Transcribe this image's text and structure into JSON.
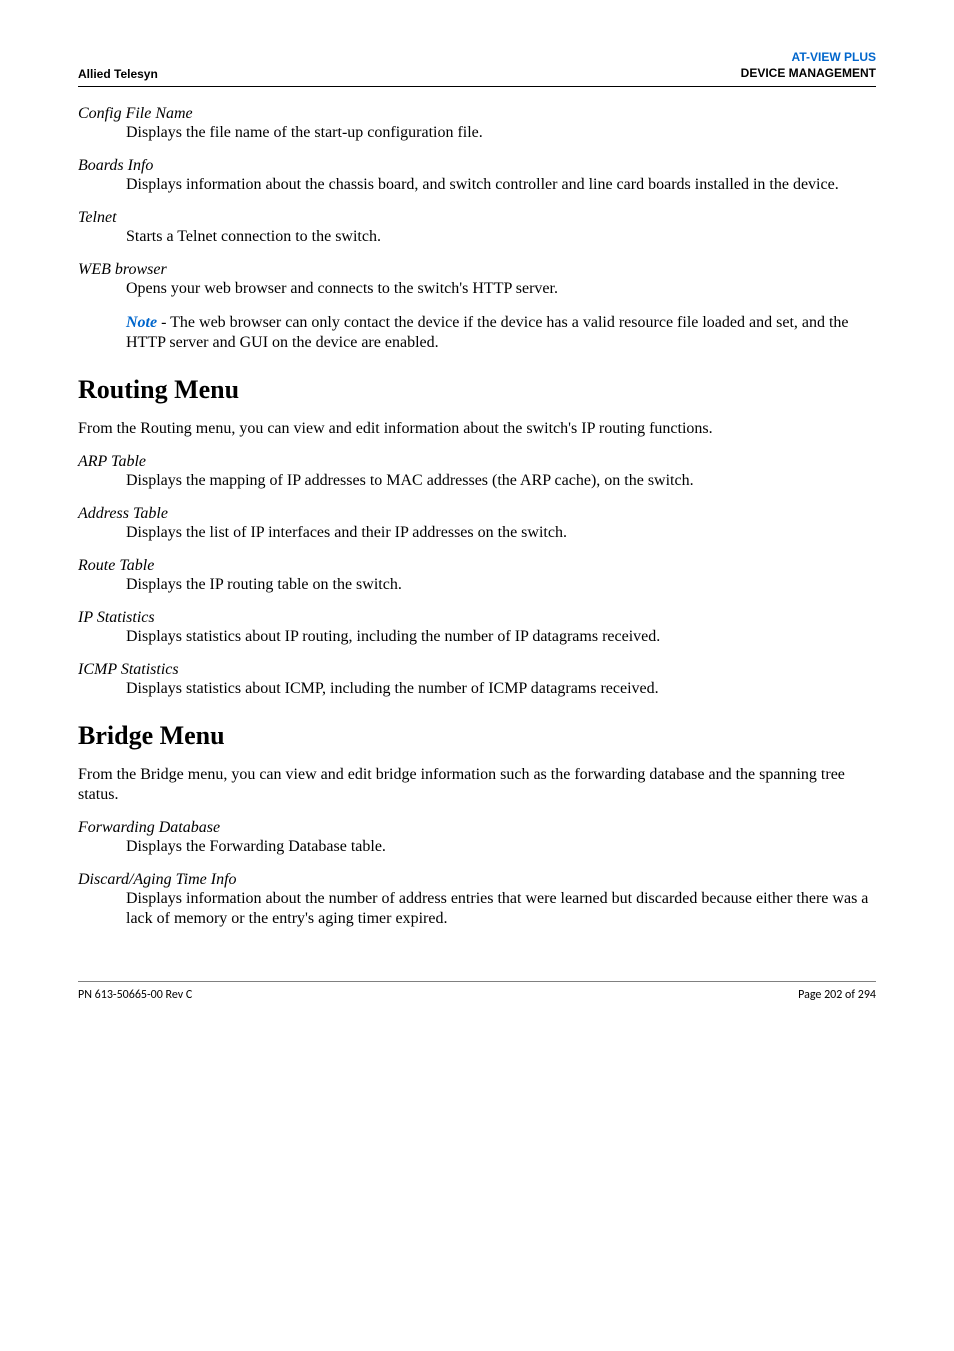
{
  "header": {
    "left": "Allied Telesyn",
    "right_line1": "AT-VIEW PLUS",
    "right_line2": "DEVICE MANAGEMENT"
  },
  "items1": {
    "config_file_name": {
      "term": "Config File Name",
      "desc": "Displays the file name of the start-up configuration file."
    },
    "boards_info": {
      "term": "Boards Info",
      "desc": "Displays information about the chassis board, and switch controller and line card boards installed in the device."
    },
    "telnet": {
      "term": "Telnet",
      "desc": "Starts a Telnet connection to the switch."
    },
    "web_browser": {
      "term": "WEB browser",
      "desc": "Opens your web browser and connects to the switch's HTTP server."
    }
  },
  "note": {
    "label": "Note",
    "text": " - The web browser can only contact the device if the device has a valid resource file loaded and set, and the HTTP server and GUI on the device are enabled."
  },
  "routing": {
    "heading": "Routing Menu",
    "intro": "From the Routing menu, you can view and edit information about the switch's IP routing functions.",
    "arp_table": {
      "term": "ARP Table",
      "desc": "Displays the mapping of IP addresses to MAC addresses (the ARP cache), on the switch."
    },
    "address_table": {
      "term": "Address Table",
      "desc": "Displays the list of IP interfaces and their IP addresses on the switch."
    },
    "route_table": {
      "term": "Route Table",
      "desc": "Displays the IP routing table on the switch."
    },
    "ip_statistics": {
      "term": "IP Statistics",
      "desc": "Displays statistics about IP routing, including the number of IP datagrams received."
    },
    "icmp_statistics": {
      "term": "ICMP Statistics",
      "desc": "Displays statistics about ICMP, including the number of ICMP datagrams received."
    }
  },
  "bridge": {
    "heading": "Bridge Menu",
    "intro": "From the Bridge menu, you can view and edit bridge information such as the forwarding database and the spanning tree status.",
    "forwarding_database": {
      "term": "Forwarding Database",
      "desc": "Displays the Forwarding Database table."
    },
    "discard_aging": {
      "term": "Discard/Aging Time Info",
      "desc": "Displays information about the number of address entries that were learned but discarded because either there was a lack of memory or the entry's aging timer expired."
    }
  },
  "footer": {
    "left": "PN 613-50665-00 Rev C",
    "right": "Page 202 of 294"
  }
}
